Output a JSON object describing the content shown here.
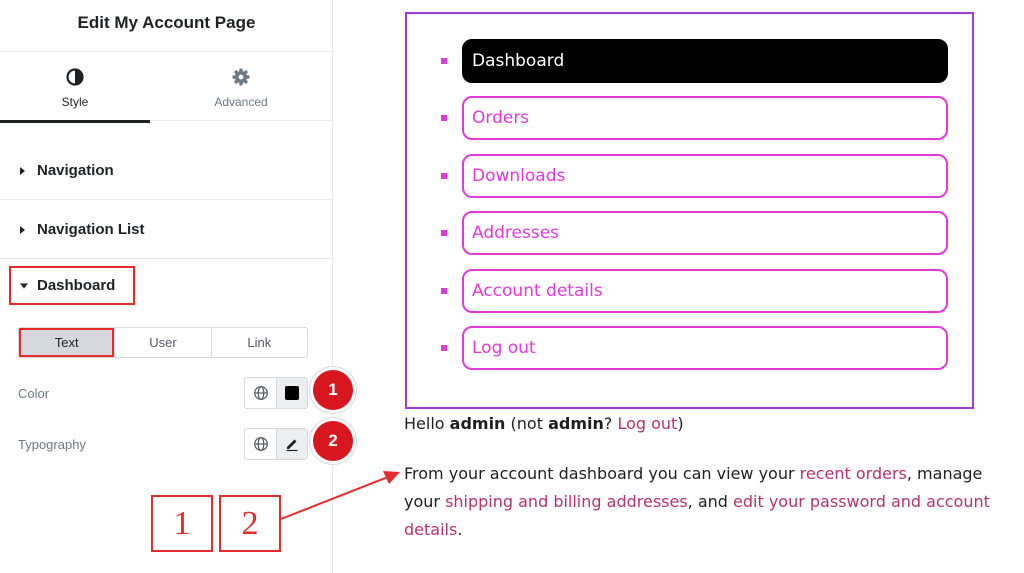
{
  "panel": {
    "title": "Edit My Account Page",
    "tabs": [
      {
        "label": "Style",
        "icon": "contrast-icon",
        "active": true
      },
      {
        "label": "Advanced",
        "icon": "gear-icon",
        "active": false
      }
    ],
    "sections": [
      {
        "label": "Navigation",
        "icon": "caret-right-icon"
      },
      {
        "label": "Navigation List",
        "icon": "caret-right-icon"
      }
    ],
    "dashboard": {
      "label": "Dashboard",
      "icon": "caret-down-icon",
      "segments": [
        "Text",
        "User",
        "Link"
      ],
      "selected_segment": "Text",
      "controls": [
        {
          "label": "Color",
          "icon": "globe-icon",
          "swatch": "#000000",
          "badge": "1"
        },
        {
          "label": "Typography",
          "icon": "globe-icon",
          "edit_icon": "pencil-icon",
          "badge": "2"
        }
      ]
    }
  },
  "callouts": {
    "box1": "1",
    "box2": "2"
  },
  "preview": {
    "nav_items": [
      {
        "label": "Dashboard",
        "active": true
      },
      {
        "label": "Orders",
        "active": false
      },
      {
        "label": "Downloads",
        "active": false
      },
      {
        "label": "Addresses",
        "active": false
      },
      {
        "label": "Account details",
        "active": false
      },
      {
        "label": "Log out",
        "active": false
      }
    ],
    "hello": {
      "pre": "Hello ",
      "user1": "admin",
      "mid": " (not ",
      "user2": "admin",
      "q": "? ",
      "logout": "Log out",
      "post": ")"
    },
    "desc": {
      "t1": "From your account dashboard you can view your ",
      "l1": "recent orders",
      "t2": ", manage your ",
      "l2": "shipping and billing addresses",
      "t3": ", and ",
      "l3": "edit your password and account details",
      "t4": "."
    }
  },
  "colors": {
    "accent_pink": "#e23ad9",
    "frame_purple": "#a03bd6",
    "link": "#b3336e",
    "highlight_red": "#e52b2b",
    "badge_red": "#d8161f"
  }
}
